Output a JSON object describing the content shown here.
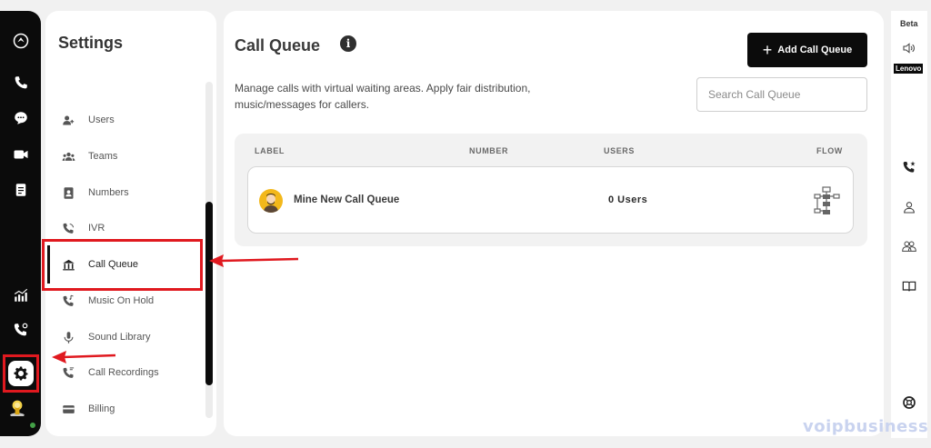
{
  "sidebar": {
    "title": "Settings",
    "items": [
      {
        "label": "Users",
        "icon": "users-icon"
      },
      {
        "label": "Teams",
        "icon": "teams-icon"
      },
      {
        "label": "Numbers",
        "icon": "numbers-icon"
      },
      {
        "label": "IVR",
        "icon": "ivr-icon"
      },
      {
        "label": "Call Queue",
        "icon": "call-queue-icon"
      },
      {
        "label": "Music On Hold",
        "icon": "music-on-hold-icon"
      },
      {
        "label": "Sound Library",
        "icon": "microphone-icon"
      },
      {
        "label": "Call Recordings",
        "icon": "call-recordings-icon"
      },
      {
        "label": "Billing",
        "icon": "billing-icon"
      }
    ],
    "active": "Call Queue"
  },
  "main": {
    "title": "Call Queue",
    "description": "Manage calls with virtual waiting areas. Apply fair distribution, music/messages for callers.",
    "add_button_label": "Add Call Queue",
    "search_placeholder": "Search Call Queue",
    "table": {
      "columns": [
        "LABEL",
        "NUMBER",
        "USERS",
        "FLOW"
      ],
      "rows": [
        {
          "label": "Mine New Call Queue",
          "number": "",
          "users": "0 Users"
        }
      ]
    }
  },
  "right_rail": {
    "beta_label": "Beta",
    "device_label": "Lenovo"
  },
  "watermark": "voipbusiness",
  "colors": {
    "accent": "#0b0b0b",
    "highlight": "#e0191f",
    "avatar": "#f3b81b"
  }
}
